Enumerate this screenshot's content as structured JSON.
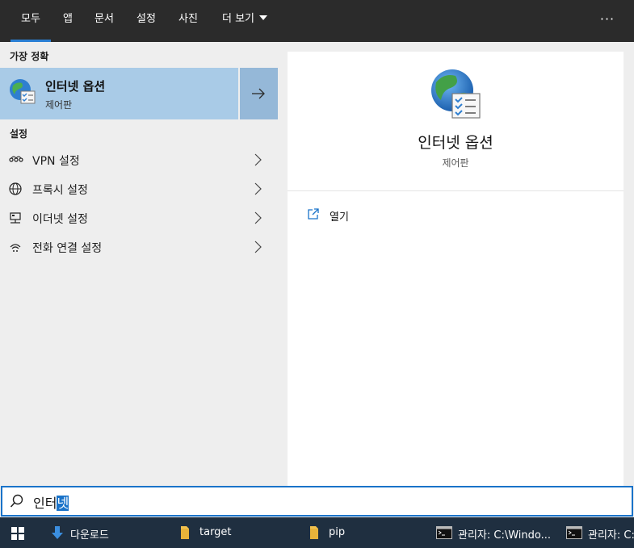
{
  "tabs": [
    "모두",
    "앱",
    "문서",
    "설정",
    "사진",
    "더 보기"
  ],
  "more_menu": "···",
  "best_match": {
    "heading": "가장 정확",
    "title": "인터넷 옵션",
    "subtitle": "제어판",
    "icon": "internet-options-globe-icon"
  },
  "settings": {
    "heading": "설정",
    "items": [
      {
        "label": "VPN 설정",
        "icon": "vpn-icon"
      },
      {
        "label": "프록시 설정",
        "icon": "globe-icon"
      },
      {
        "label": "이더넷 설정",
        "icon": "ethernet-icon"
      },
      {
        "label": "전화 연결 설정",
        "icon": "dial-up-icon"
      }
    ]
  },
  "preview": {
    "title": "인터넷 옵션",
    "subtitle": "제어판",
    "actions": [
      {
        "label": "열기",
        "icon": "open-icon"
      }
    ]
  },
  "search": {
    "typed": "인터",
    "selected": "넷"
  },
  "taskbar": {
    "items": [
      {
        "label": "다운로드",
        "icon": "download-arrow-icon"
      },
      {
        "label": "target",
        "icon": "folder-icon"
      },
      {
        "label": "pip",
        "icon": "folder-icon"
      },
      {
        "label": "관리자: C:\\Windo...",
        "icon": "cmd-icon"
      },
      {
        "label": "관리자: C:\\",
        "icon": "cmd-icon"
      }
    ]
  },
  "colors": {
    "accent": "#1a73c9",
    "top_bar": "#2b2b2b",
    "best_match_bg": "#a9cbe7",
    "taskbar": "#1f2f40"
  }
}
